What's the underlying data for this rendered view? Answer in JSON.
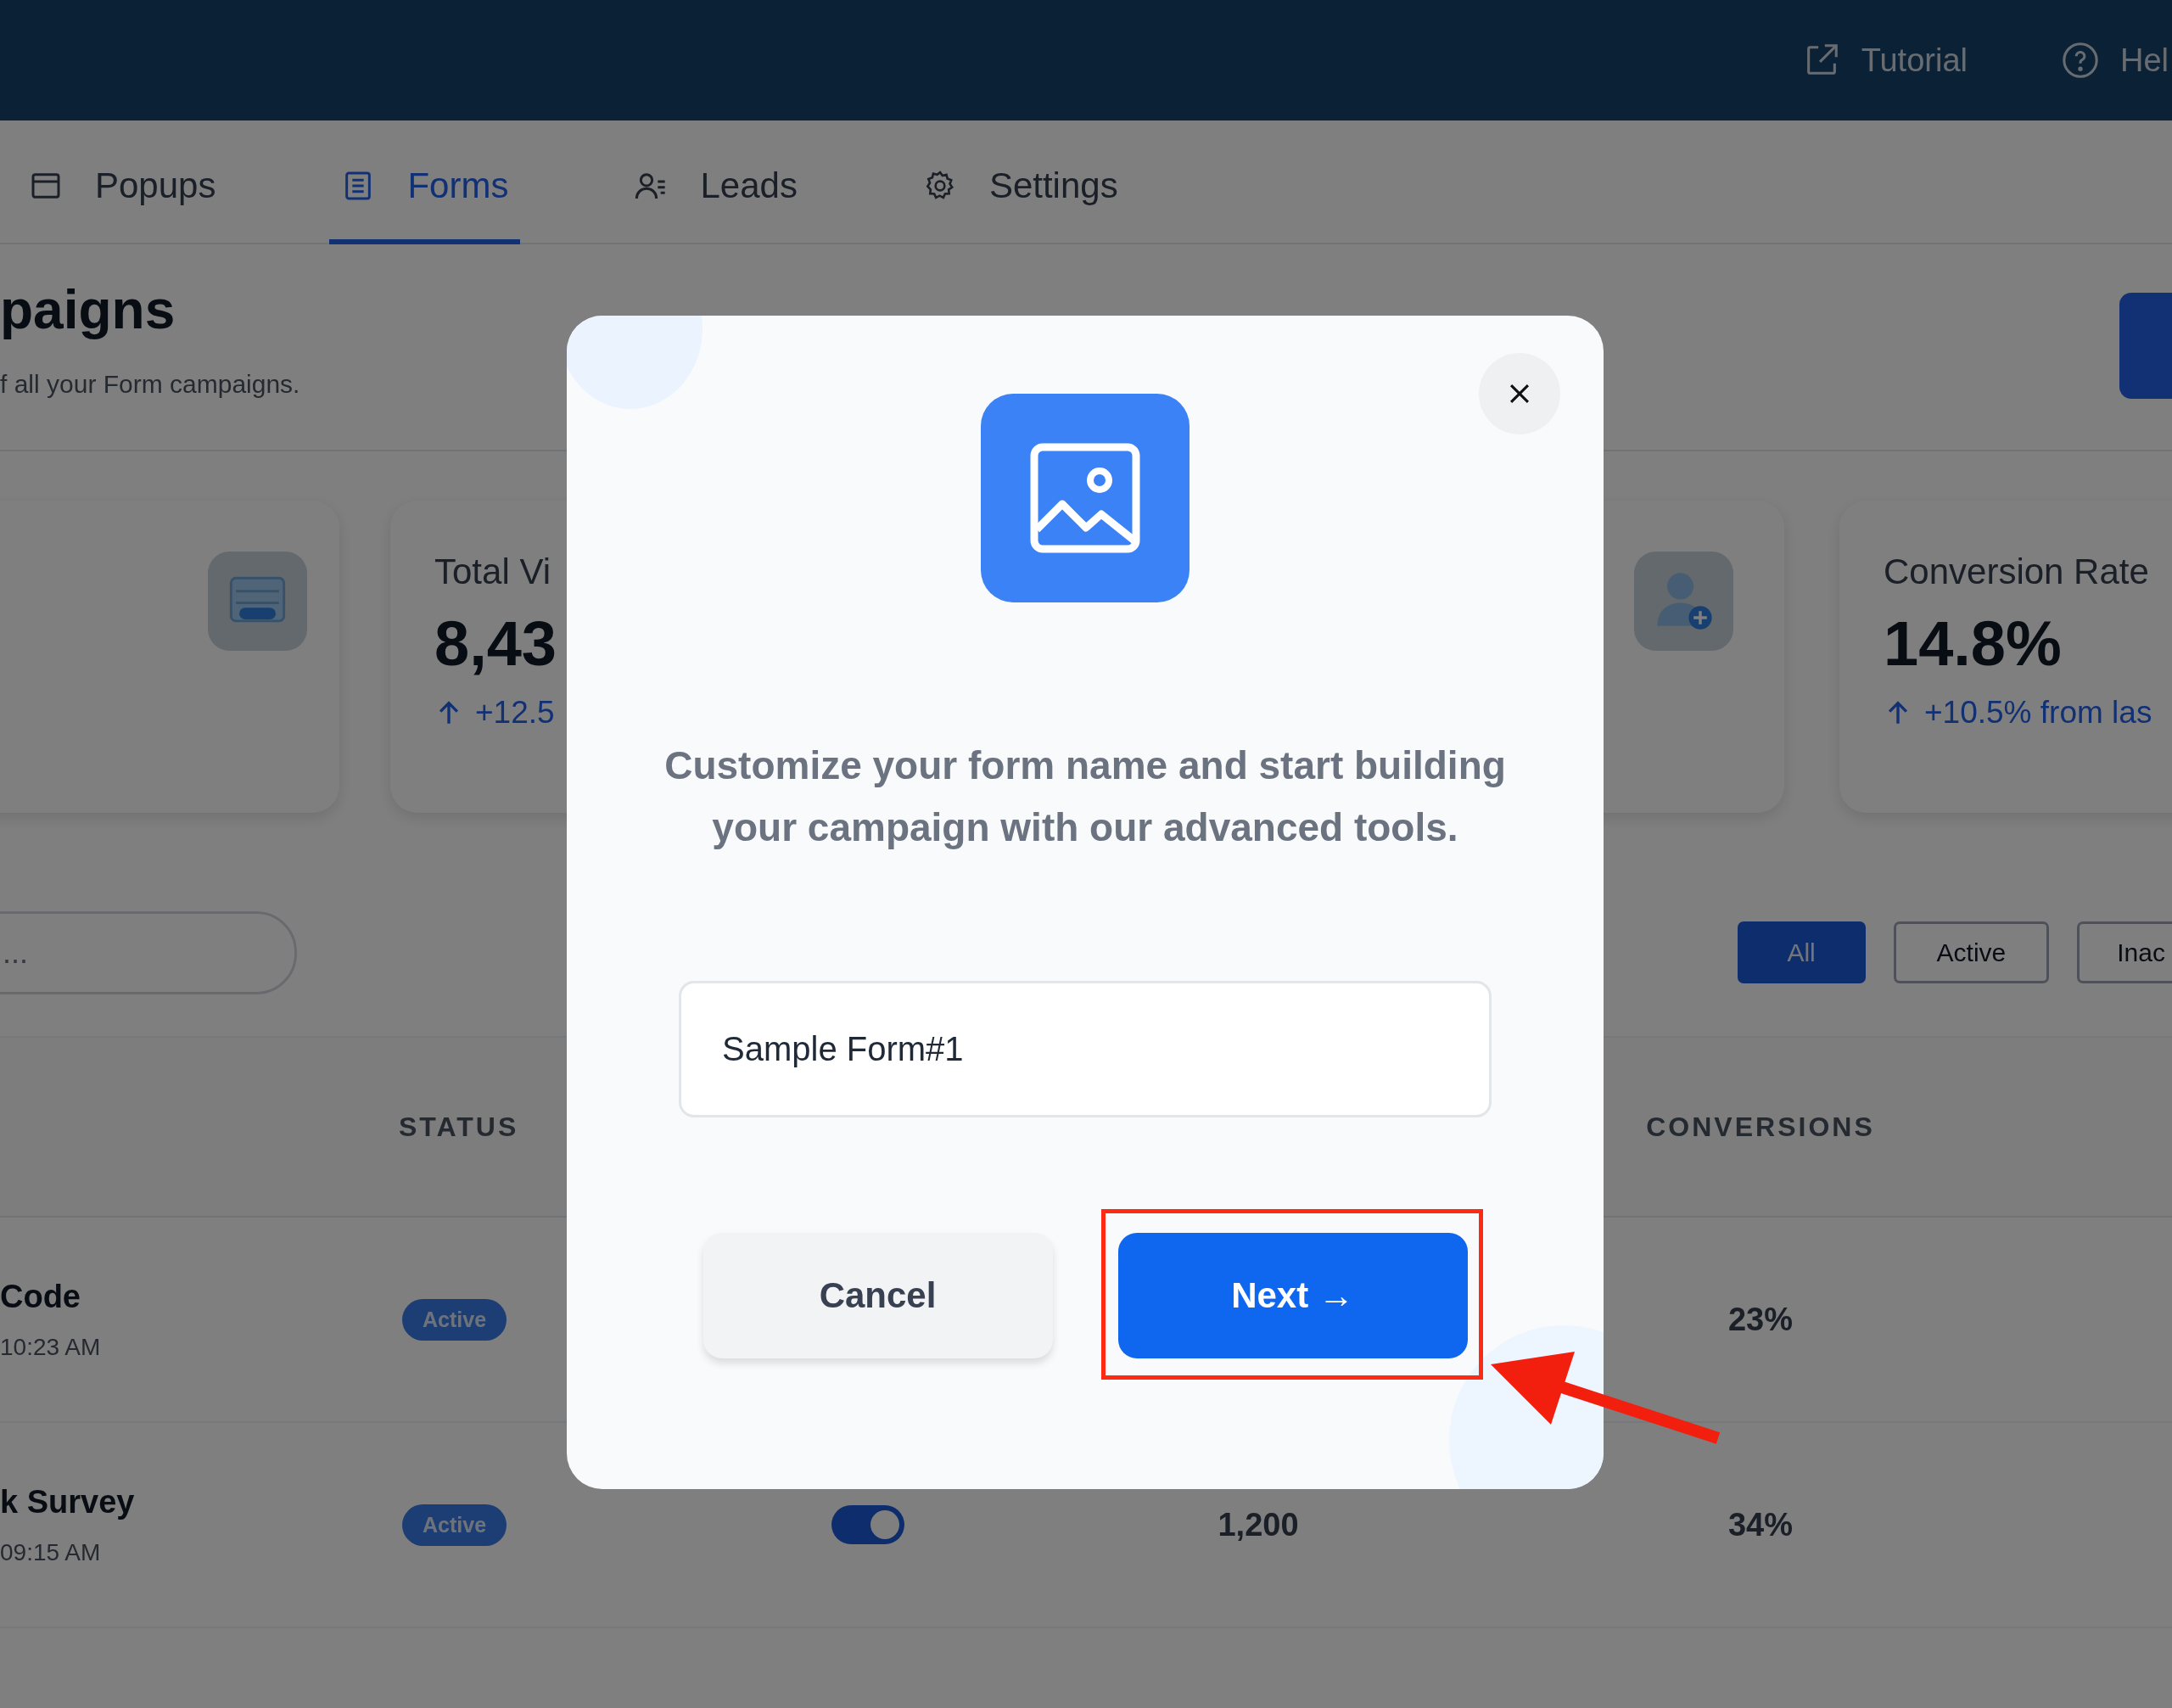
{
  "top_bar": {
    "links": [
      {
        "label": "Tutorial",
        "kind": "external"
      },
      {
        "label": "Hel",
        "kind": "help"
      }
    ]
  },
  "tabs": [
    {
      "label": "Popups",
      "kind": "window",
      "selected": false
    },
    {
      "label": "Forms",
      "kind": "list",
      "selected": true
    },
    {
      "label": "Leads",
      "kind": "users",
      "selected": false
    },
    {
      "label": "Settings",
      "kind": "gear",
      "selected": false
    }
  ],
  "header": {
    "title": "paigns",
    "subtitle": "f all your Form campaigns."
  },
  "stat_cards": [
    {
      "kind": "form"
    },
    {
      "label": "Total Vi",
      "value": "8,43",
      "change": "+12.5"
    },
    {
      "kind": "user-add"
    },
    {
      "label": "Conversion Rate",
      "value": "14.8%",
      "change": "+10.5% from las"
    }
  ],
  "search": {
    "placeholder": "..."
  },
  "filters": [
    {
      "label": "All",
      "selected": true
    },
    {
      "label": "Active",
      "selected": false
    },
    {
      "label": "Inac",
      "selected": false
    }
  ],
  "table": {
    "columns": [
      {
        "label": "STATUS"
      },
      {
        "label": "CONVERSIONS"
      }
    ],
    "rows": [
      {
        "name": "Code",
        "time": "10:23 AM",
        "status": "Active",
        "conversions": "23%"
      },
      {
        "name": "k Survey",
        "time": "09:15 AM",
        "status": "Active",
        "enabled": true,
        "views": "1,200",
        "conversions": "34%"
      }
    ]
  },
  "modal": {
    "message": "Customize your form name and start building your campaign with our advanced tools.",
    "name_field": {
      "value": "Sample Form#1"
    },
    "buttons": [
      {
        "label": "Cancel",
        "kind": "secondary"
      },
      {
        "label": "Next →",
        "kind": "primary",
        "highlighted": true
      }
    ]
  }
}
